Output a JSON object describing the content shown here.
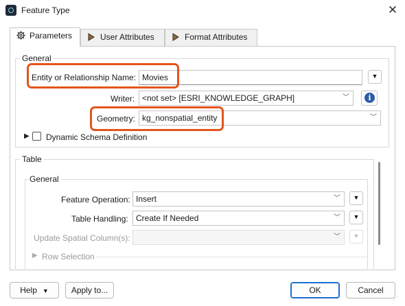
{
  "window": {
    "title": "Feature Type",
    "close_glyph": "✕"
  },
  "tabs": [
    {
      "label": "Parameters",
      "icon": "gear-icon",
      "active": true
    },
    {
      "label": "User Attributes",
      "icon": "arrow-right-icon",
      "active": false
    },
    {
      "label": "Format Attributes",
      "icon": "arrow-right-icon",
      "active": false
    }
  ],
  "general": {
    "title": "General",
    "entity_label": "Entity or Relationship Name:",
    "entity_value": "Movies",
    "writer_label": "Writer:",
    "writer_value": "<not set> [ESRI_KNOWLEDGE_GRAPH]",
    "geometry_label": "Geometry:",
    "geometry_value": "kg_nonspatial_entity",
    "dynamic_schema_label": "Dynamic Schema Definition",
    "dynamic_schema_checked": false
  },
  "table": {
    "title": "Table",
    "general_title": "General",
    "feature_operation_label": "Feature Operation:",
    "feature_operation_value": "Insert",
    "table_handling_label": "Table Handling:",
    "table_handling_value": "Create If Needed",
    "update_spatial_label": "Update Spatial Column(s):",
    "update_spatial_value": "",
    "row_selection_label": "Row Selection"
  },
  "footer": {
    "help_label": "Help",
    "apply_label": "Apply to...",
    "ok_label": "OK",
    "cancel_label": "Cancel"
  },
  "colors": {
    "highlight": "#e4541c",
    "primary_border": "#1a6ed1",
    "info_icon": "#2c5ba8"
  }
}
